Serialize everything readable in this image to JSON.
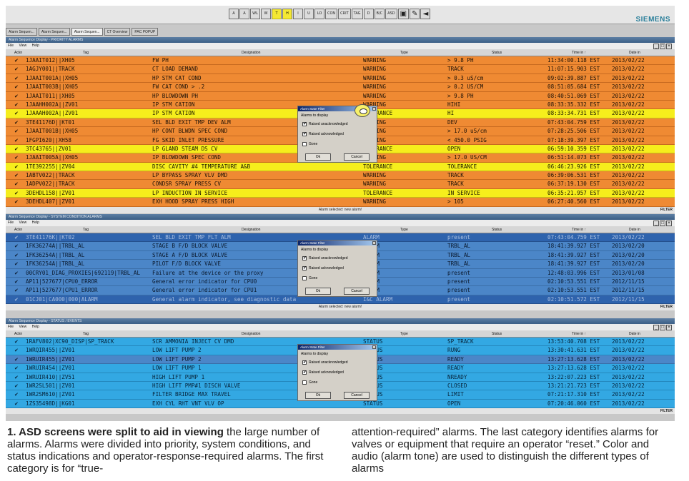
{
  "toolbar": {
    "buttons": [
      "A",
      "A",
      "WL",
      "W",
      "T",
      "H",
      "I",
      "U",
      "LO",
      "CON",
      "CRIT",
      "TAG",
      "D",
      "B/C",
      "ASD"
    ],
    "icon_buttons": [
      "image-icon",
      "pencil-icon",
      "speaker-icon"
    ],
    "brand": "SIEMENS"
  },
  "tabs": [
    "Alarm Sequen...",
    "Alarm Sequen...",
    "Alarm Sequen...",
    "CT Overview",
    "PAC POPUP"
  ],
  "menu": [
    "File",
    "View",
    "Help"
  ],
  "columns": {
    "ack": "Ackn",
    "tag": "Tag",
    "designation": "Designation",
    "type": "Type",
    "status": "Status",
    "time": "Time in ↑",
    "date": "Date in"
  },
  "footer_text": "Alarm selected: new alarm!",
  "filter_label": "FILTER",
  "panels": {
    "priority": {
      "title": "Alarm Sequence Display - PRIORITY ALARMS",
      "rows": [
        {
          "color": "orange",
          "tag": "1JAAIT012||XH05",
          "designation": "FW PH",
          "type": "WARNING",
          "status": "> 9.8 PH",
          "time": "11:34:00.118 EST",
          "date": "2013/02/22"
        },
        {
          "color": "orange",
          "tag": "1AGJY001||TRACK",
          "designation": "CT LOAD DEMAND",
          "type": "WARNING",
          "status": "TRACK",
          "time": "11:07:15.903 EST",
          "date": "2013/02/22"
        },
        {
          "color": "orange",
          "tag": "1JAAIT001A||XH05",
          "designation": "HP STM CAT COND",
          "type": "WARNING",
          "status": "> 0.3 uS/cm",
          "time": "09:02:39.887 EST",
          "date": "2013/02/22"
        },
        {
          "color": "orange",
          "tag": "1JAAIT003B||XH05",
          "designation": "FW CAT COND > .2",
          "type": "WARNING",
          "status": "> 0.2 US/CM",
          "time": "08:51:05.684 EST",
          "date": "2013/02/22"
        },
        {
          "color": "orange",
          "tag": "1JAAIT011||XH05",
          "designation": "HP BLOWDOWN PH",
          "type": "WARNING",
          "status": "> 9.8 PH",
          "time": "08:40:51.069 EST",
          "date": "2013/02/22"
        },
        {
          "color": "orange",
          "tag": "1JAAHH002A||ZV01",
          "designation": "IP STM CATION",
          "type": "WARNING",
          "status": "HIHI",
          "time": "08:33:35.332 EST",
          "date": "2013/02/22"
        },
        {
          "color": "yellow",
          "tag": "1JAAAH002A||ZV01",
          "designation": "IP STM CATION",
          "type": "TOLERANCE",
          "status": "HI",
          "time": "08:33:34.731 EST",
          "date": "2013/02/22"
        },
        {
          "color": "orange",
          "tag": "3TE41176D||KT01",
          "designation": "SEL BLD EXIT TMP DEV ALM",
          "type": "WARNING",
          "status": "DEV",
          "time": "07:43:04.759 EST",
          "date": "2013/02/22"
        },
        {
          "color": "orange",
          "tag": "1JAAIT001B||XH05",
          "designation": "HP CONT BLWDN SPEC COND",
          "type": "WARNING",
          "status": "> 17.0 uS/cm",
          "time": "07:28:25.506 EST",
          "date": "2013/02/22"
        },
        {
          "color": "orange",
          "tag": "1FGPI620||XH58",
          "designation": "FG SKID INLET PRESSURE",
          "type": "WARNING",
          "status": "< 450.0 PSIG",
          "time": "07:18:39.397 EST",
          "date": "2013/02/22"
        },
        {
          "color": "yellow",
          "tag": "3TC43765||ZV01",
          "designation": "LP GLAND STEAM DS CV",
          "type": "TOLERANCE",
          "status": "OPEN",
          "time": "06:59:10.359 EST",
          "date": "2013/02/22"
        },
        {
          "color": "orange",
          "tag": "1JAAIT005A||XH05",
          "designation": "IP BLOWDOWN SPEC COND",
          "type": "WARNING",
          "status": "> 17.0 US/CM",
          "time": "06:51:14.073 EST",
          "date": "2013/02/22"
        },
        {
          "color": "yellow",
          "tag": "1TE392255||ZV04",
          "designation": "DISC CAVITY #4 TEMPERATURE A&B",
          "type": "TOLERANCE",
          "status": "TOLERANCE",
          "time": "06:46:23.926 EST",
          "date": "2013/02/22"
        },
        {
          "color": "orange",
          "tag": "1ABTV022||TRACK",
          "designation": "LP BYPASS SPRAY VLV DMD",
          "type": "WARNING",
          "status": "TRACK",
          "time": "06:39:06.531 EST",
          "date": "2013/02/22"
        },
        {
          "color": "orange",
          "tag": "1ADPV022||TRACK",
          "designation": "CONDSR SPRAY PRESS CV",
          "type": "WARNING",
          "status": "TRACK",
          "time": "06:37:19.130 EST",
          "date": "2013/02/22"
        },
        {
          "color": "yellow",
          "tag": "3DEHDL158||ZV01",
          "designation": "LP INDUCTION IN SERVICE",
          "type": "TOLERANCE",
          "status": "IN SERVICE",
          "time": "06:35:21.957 EST",
          "date": "2013/02/22"
        },
        {
          "color": "orange",
          "tag": "3DEHDL407||ZV01",
          "designation": "EXH HOOD SPRAY PRESS HIGH",
          "type": "WARNING",
          "status": "> 105",
          "time": "06:27:40.560 EST",
          "date": "2013/02/22"
        }
      ]
    },
    "condition": {
      "title": "Alarm Sequence Display - SYSTEM CONDITION ALARMS",
      "rows": [
        {
          "color": "dblue",
          "tag": "3TE41176K||KT02",
          "designation": "SEL BLD EXIT TMP FLT ALM",
          "type": "ALARM",
          "status": "present",
          "time": "07:43:04.759 EST",
          "date": "2013/02/22"
        },
        {
          "color": "blue",
          "tag": "1FK36274A||TRBL_AL",
          "designation": "STAGE B F/D BLOCK VALVE",
          "type": "ALARM",
          "status": "TRBL_AL",
          "time": "18:41:39.927 EST",
          "date": "2013/02/20"
        },
        {
          "color": "blue",
          "tag": "1FK36254A||TRBL_AL",
          "designation": "STAGE A F/D BLOCK VALVE",
          "type": "ALARM",
          "status": "TRBL_AL",
          "time": "18:41:39.927 EST",
          "date": "2013/02/20"
        },
        {
          "color": "blue",
          "tag": "1FK36254A||TRBL_AL",
          "designation": "PILOT F/D BLOCK VALVE",
          "type": "ALARM",
          "status": "TRBL_AL",
          "time": "18:41:39.927 EST",
          "date": "2013/02/20"
        },
        {
          "color": "blue",
          "tag": "00CRY01_DIAG_PROXIES|692119|TRBL_AL",
          "designation": "Failure at the device or the proxy",
          "type": "ALARM",
          "status": "present",
          "time": "12:48:03.996 EST",
          "date": "2013/01/08"
        },
        {
          "color": "blue",
          "tag": "AP11|527677|CPU0_ERROR",
          "designation": "General error indicator for CPU0",
          "type": "ALARM",
          "status": "present",
          "time": "02:10:53.551 EST",
          "date": "2012/11/15"
        },
        {
          "color": "blue",
          "tag": "AP11|527677|CPU1_ERROR",
          "designation": "General error indicator for CPU1",
          "type": "ALARM",
          "status": "present",
          "time": "02:10:53.551 EST",
          "date": "2012/11/15"
        },
        {
          "color": "dblue",
          "tag": "01CJ01|CA000|000|ALARM",
          "designation": "General alarm indicator, see diagnostic data",
          "type": "I&C ALARM",
          "status": "present",
          "time": "02:10:51.572 EST",
          "date": "2012/11/15"
        }
      ]
    },
    "status": {
      "title": "Alarm Sequence Display - STATUS / EVENTS",
      "rows": [
        {
          "color": "cyan",
          "tag": "1RAFV802|XC90_DISP|SP_TRACK",
          "designation": "SCR AMMONIA INJECT CV DMD",
          "type": "STATUS",
          "status": "SP_TRACK",
          "time": "13:53:40.708 EST",
          "date": "2013/02/22"
        },
        {
          "color": "cyan",
          "tag": "1WRQIR455||ZV01",
          "designation": "LOW LIFT PUMP 2",
          "type": "STATUS",
          "status": "RUNG",
          "time": "13:30:41.631 EST",
          "date": "2013/02/22"
        },
        {
          "color": "blue",
          "tag": "1WRUIR455||ZV01",
          "designation": "LOW LIFT PUMP 2",
          "type": "STATUS",
          "status": "READY",
          "time": "13:27:13.628 EST",
          "date": "2013/02/22"
        },
        {
          "color": "cyan",
          "tag": "1WRUIR454||ZV01",
          "designation": "LOW LIFT PUMP 1",
          "type": "STATUS",
          "status": "READY",
          "time": "13:27:13.628 EST",
          "date": "2013/02/22"
        },
        {
          "color": "cyan",
          "tag": "1WRUIR410||ZV51",
          "designation": "HIGH LIFT PUMP 1",
          "type": "STATUS",
          "status": "NREADY",
          "time": "13:22:07.223 EST",
          "date": "2013/02/22"
        },
        {
          "color": "cyan",
          "tag": "1WR2SL501||ZV01",
          "designation": "HIGH LIFT PMP#1 DISCH VALVE",
          "type": "STATUS",
          "status": "CLOSED",
          "time": "13:21:21.723 EST",
          "date": "2013/02/22"
        },
        {
          "color": "cyan",
          "tag": "1WR2SM610||ZV01",
          "designation": "FILTER BRIDGE MAX TRAVEL",
          "type": "STATUS",
          "status": "LIMIT",
          "time": "07:21:17.310 EST",
          "date": "2013/02/22"
        },
        {
          "color": "cyan",
          "tag": "1ZS35498D||KG01",
          "designation": "EXH CYL RHT VNT VLV OP",
          "type": "STATUS",
          "status": "OPEN",
          "time": "07:20:46.060 EST",
          "date": "2013/02/22"
        }
      ]
    }
  },
  "dialog": {
    "title": "Alarm State Filter",
    "label": "Alarms to display",
    "options": [
      "Raised unacknowledged",
      "Raised acknowledged",
      "Gone"
    ],
    "checked": [
      "✔",
      "✔",
      ""
    ],
    "ok": "Ok",
    "cancel": "Cancel"
  },
  "caption": {
    "bold": "1. ASD screens were split to aid in viewing",
    "left_rest": " the large number of alarms. Alarms were divided into priority, system conditions, and status indications and operator-response-required alarms. The first category is for “true-",
    "right": "attention-required” alarms. The last category identifies alarms for valves or equipment that require an operator “reset.” Color and audio (alarm tone) are used to distinguish the different types of alarms"
  }
}
